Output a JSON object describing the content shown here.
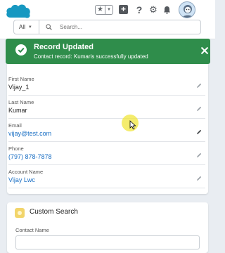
{
  "header": {
    "logo": "cloud-logo",
    "icons": [
      "star-icon",
      "chevron-down-icon",
      "plus-icon",
      "help-icon",
      "gear-icon",
      "bell-icon",
      "avatar"
    ],
    "search": {
      "scope": "All",
      "placeholder": "Search..."
    }
  },
  "toast": {
    "title": "Record Updated",
    "message": "Contact record: Kumaris successfully updated"
  },
  "record": {
    "fields": [
      {
        "label": "First Name",
        "value": "Vijay_1"
      },
      {
        "label": "Last Name",
        "value": "Kumar"
      },
      {
        "label": "Email",
        "value": "vijay@test.com"
      },
      {
        "label": "Phone",
        "value": "(797) 878-7878"
      },
      {
        "label": "Account Name",
        "value": "Vijay Lwc"
      }
    ]
  },
  "custom_search": {
    "title": "Custom Search",
    "contact_name_label": "Contact Name",
    "contact_name_value": ""
  },
  "colors": {
    "toast_bg": "#2f8d4b",
    "link": "#1a6fc4",
    "brand": "#1798c1"
  }
}
